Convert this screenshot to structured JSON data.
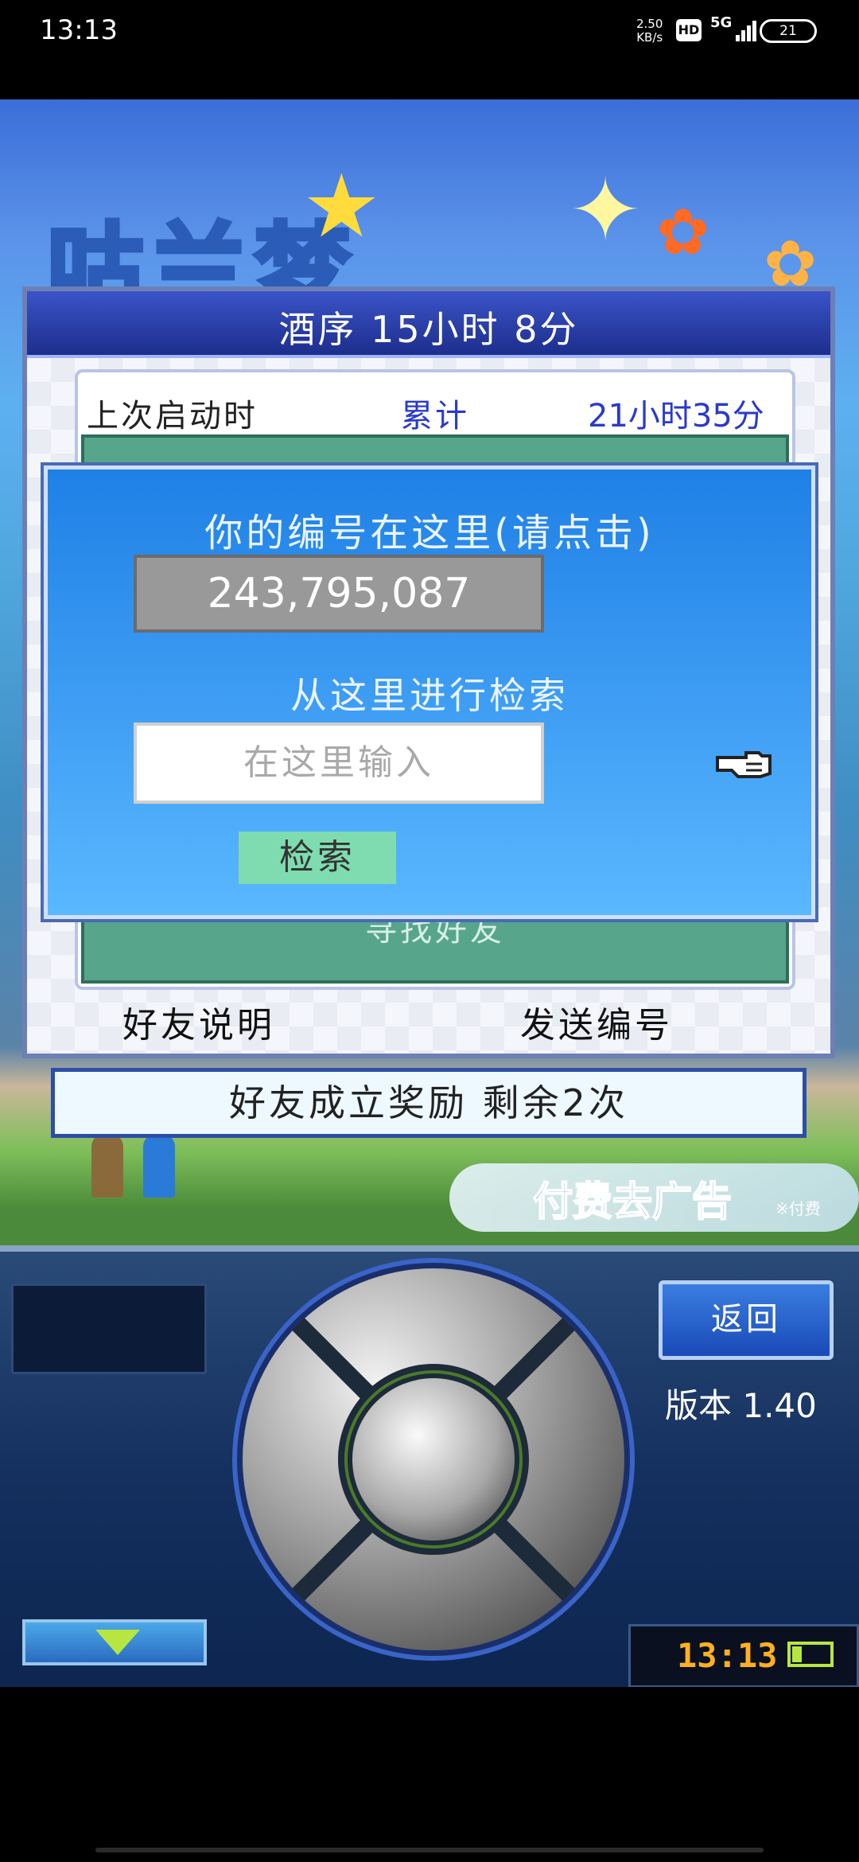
{
  "status_bar": {
    "time": "13:13",
    "speed": "2.50\nKB/s",
    "hd": "HD",
    "network": "5G",
    "battery": "21"
  },
  "game": {
    "logo_text": "咕兰梦",
    "panel": {
      "title": "酒序  15小时 8分",
      "last_launch_label": "上次启动时",
      "total_label": "累计",
      "total_value": "21小时35分",
      "teal_button": "寻找好友",
      "friend_info_button": "好友说明",
      "send_id_button": "发送编号"
    },
    "dialog": {
      "title": "你的编号在这里(请点击)",
      "player_id": "243,795,087",
      "search_prompt": "从这里进行检索",
      "search_placeholder": "在这里输入",
      "search_button": "检索"
    },
    "bonus_bar": "好友成立奖励  剩余2次",
    "ad_banner": {
      "text": "付费去广告",
      "small": "※付费"
    }
  },
  "controller": {
    "back_button": "返回",
    "version": "版本 1.40",
    "clock": "13:13"
  },
  "colors": {
    "panel_title_bg": "#1d2e8c",
    "dialog_bg": "#2a8ef0",
    "search_button_bg": "#7fdcb0",
    "teal_box": "#57a58b",
    "clock_text": "#ffb020"
  }
}
